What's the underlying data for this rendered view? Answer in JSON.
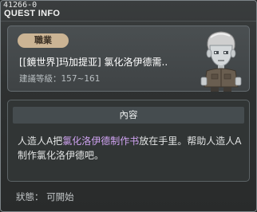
{
  "window": {
    "quest_id": "41266-0",
    "title": "QUEST INFO"
  },
  "info": {
    "job_badge": "職業",
    "quest_name": "[[鏡世界]玛加提亚] 氯化洛伊德需..",
    "level_range": "建議等級：157~161"
  },
  "content": {
    "header": "內容",
    "desc_prefix": "人造人A把",
    "desc_highlight": "氯化洛伊德制作书",
    "desc_suffix": "放在手里。帮助人造人A制作氯化洛伊德吧。"
  },
  "status": {
    "text": "狀態： 可開始"
  },
  "colors": {
    "highlight": "#d0a3f2",
    "badge": "#cbb494"
  }
}
